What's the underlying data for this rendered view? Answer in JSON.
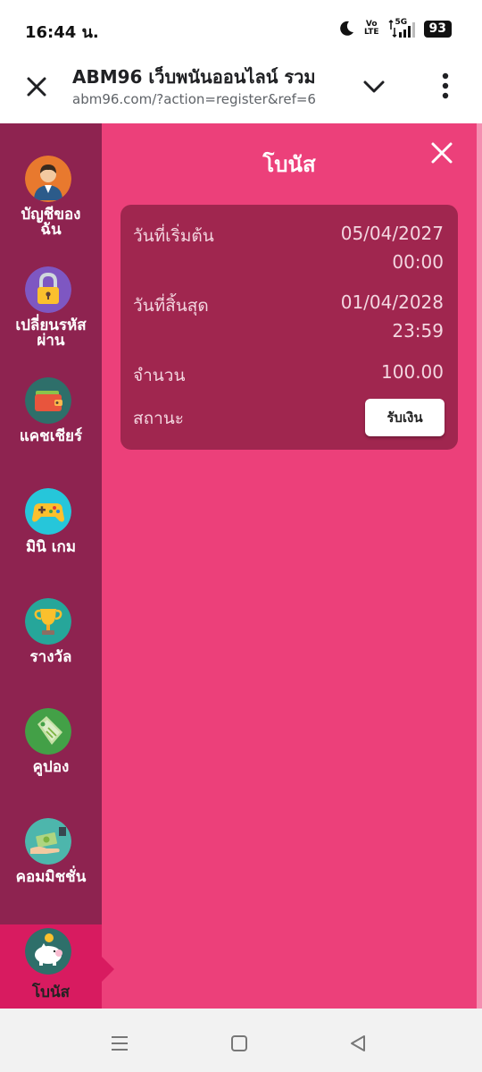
{
  "status_bar": {
    "time": "16:44 น.",
    "volte_top": "Vo",
    "volte_bottom": "LTE",
    "network": "5G",
    "battery": "93"
  },
  "browser": {
    "title": "ABM96 เว็บพนันออนไลน์ รวม",
    "url": "abm96.com/?action=register&ref=6"
  },
  "sidebar": {
    "items": [
      {
        "label_line1": "บัญชีของ",
        "label_line2": "ฉัน",
        "icon": "user-account-icon",
        "color": "#e8792e"
      },
      {
        "label_line1": "เปลี่ยนรหัส",
        "label_line2": "ผ่าน",
        "icon": "padlock-icon",
        "color": "#7e57c2"
      },
      {
        "label_line1": "แคชเชียร์",
        "label_line2": "",
        "icon": "wallet-icon",
        "color": "#2e6f6a"
      },
      {
        "label_line1": "มินิ เกม",
        "label_line2": "",
        "icon": "gamepad-icon",
        "color": "#26c6da"
      },
      {
        "label_line1": "รางวัล",
        "label_line2": "",
        "icon": "trophy-icon",
        "color": "#26a69a"
      },
      {
        "label_line1": "คูปอง",
        "label_line2": "",
        "icon": "coupon-tag-icon",
        "color": "#43a047"
      },
      {
        "label_line1": "คอมมิชชั่น",
        "label_line2": "",
        "icon": "commission-cash-icon",
        "color": "#4db6ac"
      },
      {
        "label_line1": "โบนัส",
        "label_line2": "",
        "icon": "piggy-bank-icon",
        "color": "#2e6f6a"
      }
    ]
  },
  "panel": {
    "title": "โบนัส",
    "card": {
      "start_label": "วันที่เริ่มต้น",
      "start_date": "05/04/2027",
      "start_time": "00:00",
      "end_label": "วันที่สิ้นสุด",
      "end_date": "01/04/2028",
      "end_time": "23:59",
      "amount_label": "จำนวน",
      "amount_value": "100.00",
      "status_label": "สถานะ",
      "claim_button": "รับเงิน"
    }
  },
  "colors": {
    "page_background": "#ec407a",
    "sidebar_background": "#8e2350",
    "active_item": "#d81b60",
    "card_background": "#a0264f"
  }
}
